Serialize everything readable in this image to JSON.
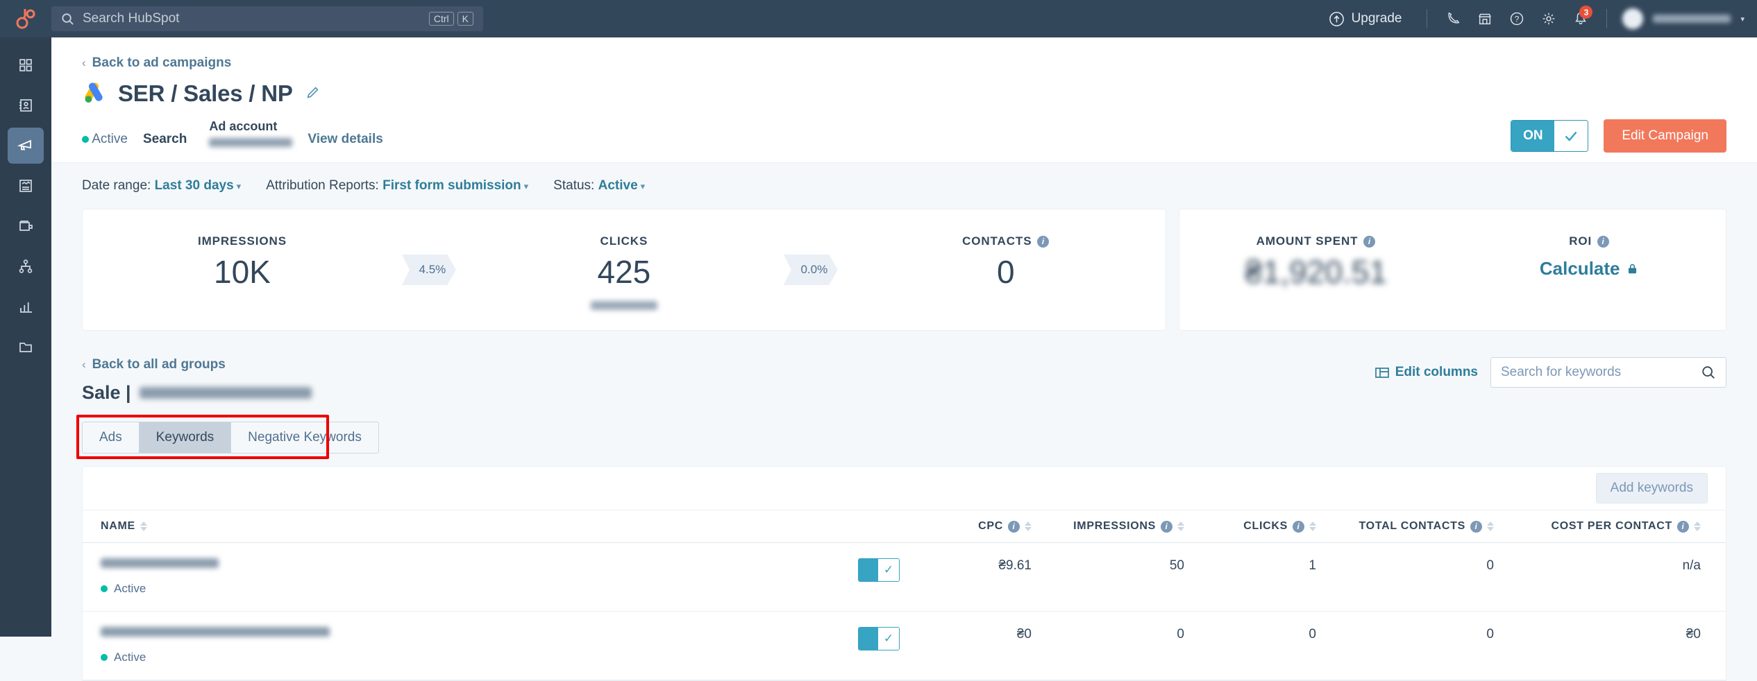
{
  "topnav": {
    "logo_icon": "hubspot-sprocket-logo",
    "search": {
      "placeholder": "Search HubSpot",
      "icon": "search-icon",
      "kbd1": "Ctrl",
      "kbd2": "K"
    },
    "upgrade_label": "Upgrade",
    "upgrade_icon": "arrow-up-circle-icon",
    "icons": [
      "phone-icon",
      "marketplace-icon",
      "help-circle-icon",
      "gear-icon",
      "notifications-bell-icon"
    ],
    "notification_count": "3"
  },
  "sidebar": {
    "items": [
      {
        "name": "dashboard",
        "icon": "grid-icon",
        "active": false
      },
      {
        "name": "contacts",
        "icon": "contacts-card-icon",
        "active": false
      },
      {
        "name": "marketing",
        "icon": "megaphone-icon",
        "active": true
      },
      {
        "name": "content",
        "icon": "content-document-icon",
        "active": false
      },
      {
        "name": "commerce",
        "icon": "wallet-icon",
        "active": false
      },
      {
        "name": "automation",
        "icon": "workflow-nodes-icon",
        "active": false
      },
      {
        "name": "reporting",
        "icon": "bar-chart-icon",
        "active": false
      },
      {
        "name": "library",
        "icon": "folder-icon",
        "active": false
      }
    ]
  },
  "header": {
    "back_link": "Back to ad campaigns",
    "title": "SER / Sales / NP",
    "network_logo_icon": "google-ads-logo",
    "edit_title_icon": "pencil-icon",
    "status": "Active",
    "channel": "Search",
    "ad_account_label": "Ad account",
    "ad_account_value": "",
    "view_details": "View details",
    "toggle_state": "ON",
    "toggle_check_icon": "check-icon",
    "edit_campaign_label": "Edit Campaign",
    "accent_teal": "#36a4c2",
    "accent_orange": "#f2785c"
  },
  "filters": [
    {
      "label": "Date range:",
      "value": "Last 30 days"
    },
    {
      "label": "Attribution Reports:",
      "value": "First form submission"
    },
    {
      "label": "Status:",
      "value": "Active"
    }
  ],
  "metrics": {
    "left": [
      {
        "label": "IMPRESSIONS",
        "value": "10K",
        "delta": "4.5%",
        "has_info": false,
        "has_sub": false
      },
      {
        "label": "CLICKS",
        "value": "425",
        "delta": "0.0%",
        "has_info": false,
        "has_sub": true
      },
      {
        "label": "CONTACTS",
        "value": "0",
        "delta": "",
        "has_info": true,
        "has_sub": false
      }
    ],
    "right": [
      {
        "label": "AMOUNT SPENT",
        "value": "₴1,920.51",
        "has_info": true,
        "blurred": true
      },
      {
        "label": "ROI",
        "value": "",
        "link": "Calculate",
        "lock_icon": "lock-icon",
        "has_info": true,
        "blurred": false
      }
    ]
  },
  "adgroup": {
    "back_link": "Back to all ad groups",
    "title_prefix": "Sale |",
    "title_blurred_value": "",
    "edit_columns": "Edit columns",
    "edit_columns_icon": "columns-icon",
    "search_placeholder": "Search for keywords",
    "search_value": "",
    "search_icon": "search-icon",
    "add_keywords_label": "Add keywords",
    "tabs": [
      {
        "label": "Ads",
        "selected": false
      },
      {
        "label": "Keywords",
        "selected": true
      },
      {
        "label": "Negative Keywords",
        "selected": false
      }
    ],
    "annotation_color": "#ee0000"
  },
  "table": {
    "columns": [
      {
        "label": "NAME",
        "info": false,
        "align": "left"
      },
      {
        "label": "",
        "info": false,
        "align": "center"
      },
      {
        "label": "CPC",
        "info": true,
        "align": "right"
      },
      {
        "label": "IMPRESSIONS",
        "info": true,
        "align": "right"
      },
      {
        "label": "CLICKS",
        "info": true,
        "align": "right"
      },
      {
        "label": "TOTAL CONTACTS",
        "info": true,
        "align": "right"
      },
      {
        "label": "COST PER CONTACT",
        "info": true,
        "align": "right"
      }
    ],
    "rows": [
      {
        "name": "",
        "status": "Active",
        "toggle": "on",
        "cpc": "₴9.61",
        "impressions": "50",
        "clicks": "1",
        "total_contacts": "0",
        "cost_per_contact": "n/a"
      },
      {
        "name": "",
        "status": "Active",
        "toggle": "on",
        "cpc": "₴0",
        "impressions": "0",
        "clicks": "0",
        "total_contacts": "0",
        "cost_per_contact": "₴0"
      }
    ]
  }
}
